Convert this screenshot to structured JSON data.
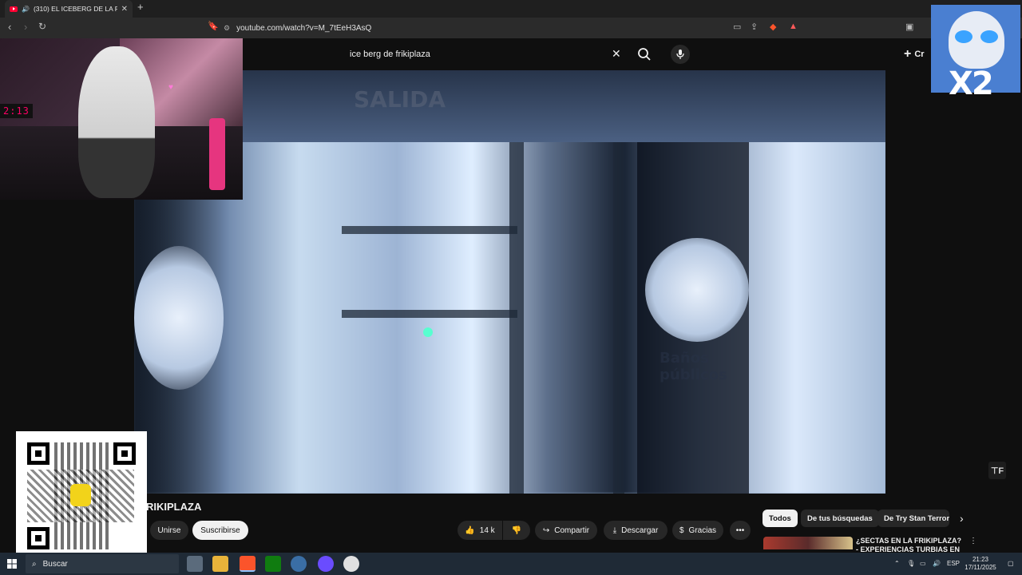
{
  "browser": {
    "tab_title": "(310) EL ICEBERG DE LA FRIKI",
    "url": "youtube.com/watch?v=M_7tEeH3AsQ"
  },
  "youtube": {
    "search_value": "ice berg de frikiplaza",
    "create_label": "Cr",
    "video_title": "RIKIPLAZA",
    "join_label": "Unirse",
    "subscribe_label": "Suscribirse",
    "like_count": "14 k",
    "share_label": "Compartir",
    "download_label": "Descargar",
    "thanks_label": "Gracias",
    "chips": [
      "Todos",
      "De tus búsquedas",
      "De Try Stan Terror"
    ],
    "recommended_title": "¿SECTAS EN LA FRIKIPLAZA? - EXPERIENCIAS TURBIAS EN L"
  },
  "overlay": {
    "logo_text": "X2",
    "webcam_clock": "2:13"
  },
  "taskbar": {
    "search_placeholder": "Buscar",
    "language": "ESP",
    "time": "21:23",
    "date": "17/11/2025"
  },
  "colors": {
    "youtube_red": "#ff0033",
    "page_bg": "#0f0f0f",
    "logo_bg": "#4a7fd1"
  }
}
